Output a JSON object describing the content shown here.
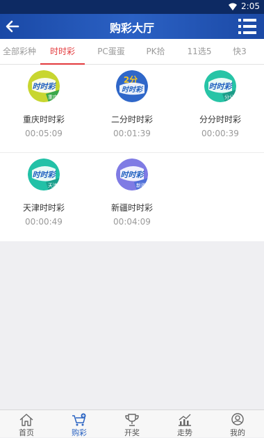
{
  "status_bar": {
    "time": "2:05"
  },
  "header": {
    "title": "购彩大厅"
  },
  "tabs": [
    {
      "label": "全部彩种",
      "active": false
    },
    {
      "label": "时时彩",
      "active": true
    },
    {
      "label": "PC蛋蛋",
      "active": false
    },
    {
      "label": "PK拾",
      "active": false
    },
    {
      "label": "11选5",
      "active": false
    },
    {
      "label": "快3",
      "active": false
    }
  ],
  "lotteries": [
    {
      "name": "重庆时时彩",
      "countdown": "00:05:09",
      "badge": "重庆",
      "badge_color": "#3aa84a",
      "logo_color": "#c8d630"
    },
    {
      "name": "二分时时彩",
      "countdown": "00:01:39",
      "badge": "2分",
      "badge_color": "#f6a623",
      "logo_color": "#2f67c9"
    },
    {
      "name": "分分时时彩",
      "countdown": "00:00:39",
      "badge": "分分",
      "badge_color": "#27b6a3",
      "logo_color": "#27c4a6"
    },
    {
      "name": "天津时时彩",
      "countdown": "00:00:49",
      "badge": "天津",
      "badge_color": "#20b3a0",
      "logo_color": "#22c1a7"
    },
    {
      "name": "新疆时时彩",
      "countdown": "00:04:09",
      "badge": "新疆",
      "badge_color": "#5f7ee0",
      "logo_color": "#7f7be4"
    }
  ],
  "bottom_nav": [
    {
      "label": "首页",
      "icon": "home-icon",
      "active": false
    },
    {
      "label": "购彩",
      "icon": "cart-icon",
      "active": true
    },
    {
      "label": "开奖",
      "icon": "trophy-icon",
      "active": false
    },
    {
      "label": "走势",
      "icon": "trend-chart-icon",
      "active": false
    },
    {
      "label": "我的",
      "icon": "user-icon",
      "active": false
    }
  ],
  "colors": {
    "primary": "#2158bd",
    "tab_active": "#e3393c",
    "nav_active": "#2a63c2"
  }
}
